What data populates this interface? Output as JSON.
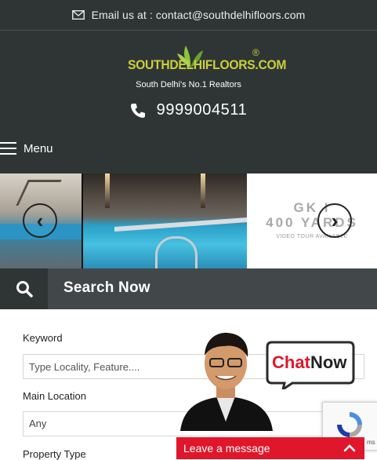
{
  "topbar": {
    "email_text": "Email us at : contact@southdelhifloors.com",
    "icon": "envelope-icon"
  },
  "header": {
    "logo_text": "SOUTHDELHIFLOORS.COM",
    "logo_mark": "®",
    "tagline": "South Delhi's No.1 Realtors",
    "phone": "9999004511",
    "phone_icon": "phone-icon",
    "menu_label": "Menu",
    "brand_color": "#c8d13a"
  },
  "slider": {
    "slide3_title_line1": "GK I",
    "slide3_title_line2": "400 YARDS",
    "slide3_subtitle": "VIDEO TOUR AVAILABLE",
    "prev_icon": "chevron-left-icon",
    "next_icon": "chevron-right-icon"
  },
  "search": {
    "title": "Search Now",
    "keyword_label": "Keyword",
    "keyword_placeholder": "Type Locality, Feature....",
    "location_label": "Main Location",
    "location_value": "Any",
    "property_type_label": "Property Type"
  },
  "chat": {
    "bubble_text_chat": "Chat",
    "bubble_text_now": "Now",
    "leave_message": "Leave a message",
    "accent": "#e0162b"
  },
  "recaptcha": {
    "text": "ms"
  }
}
